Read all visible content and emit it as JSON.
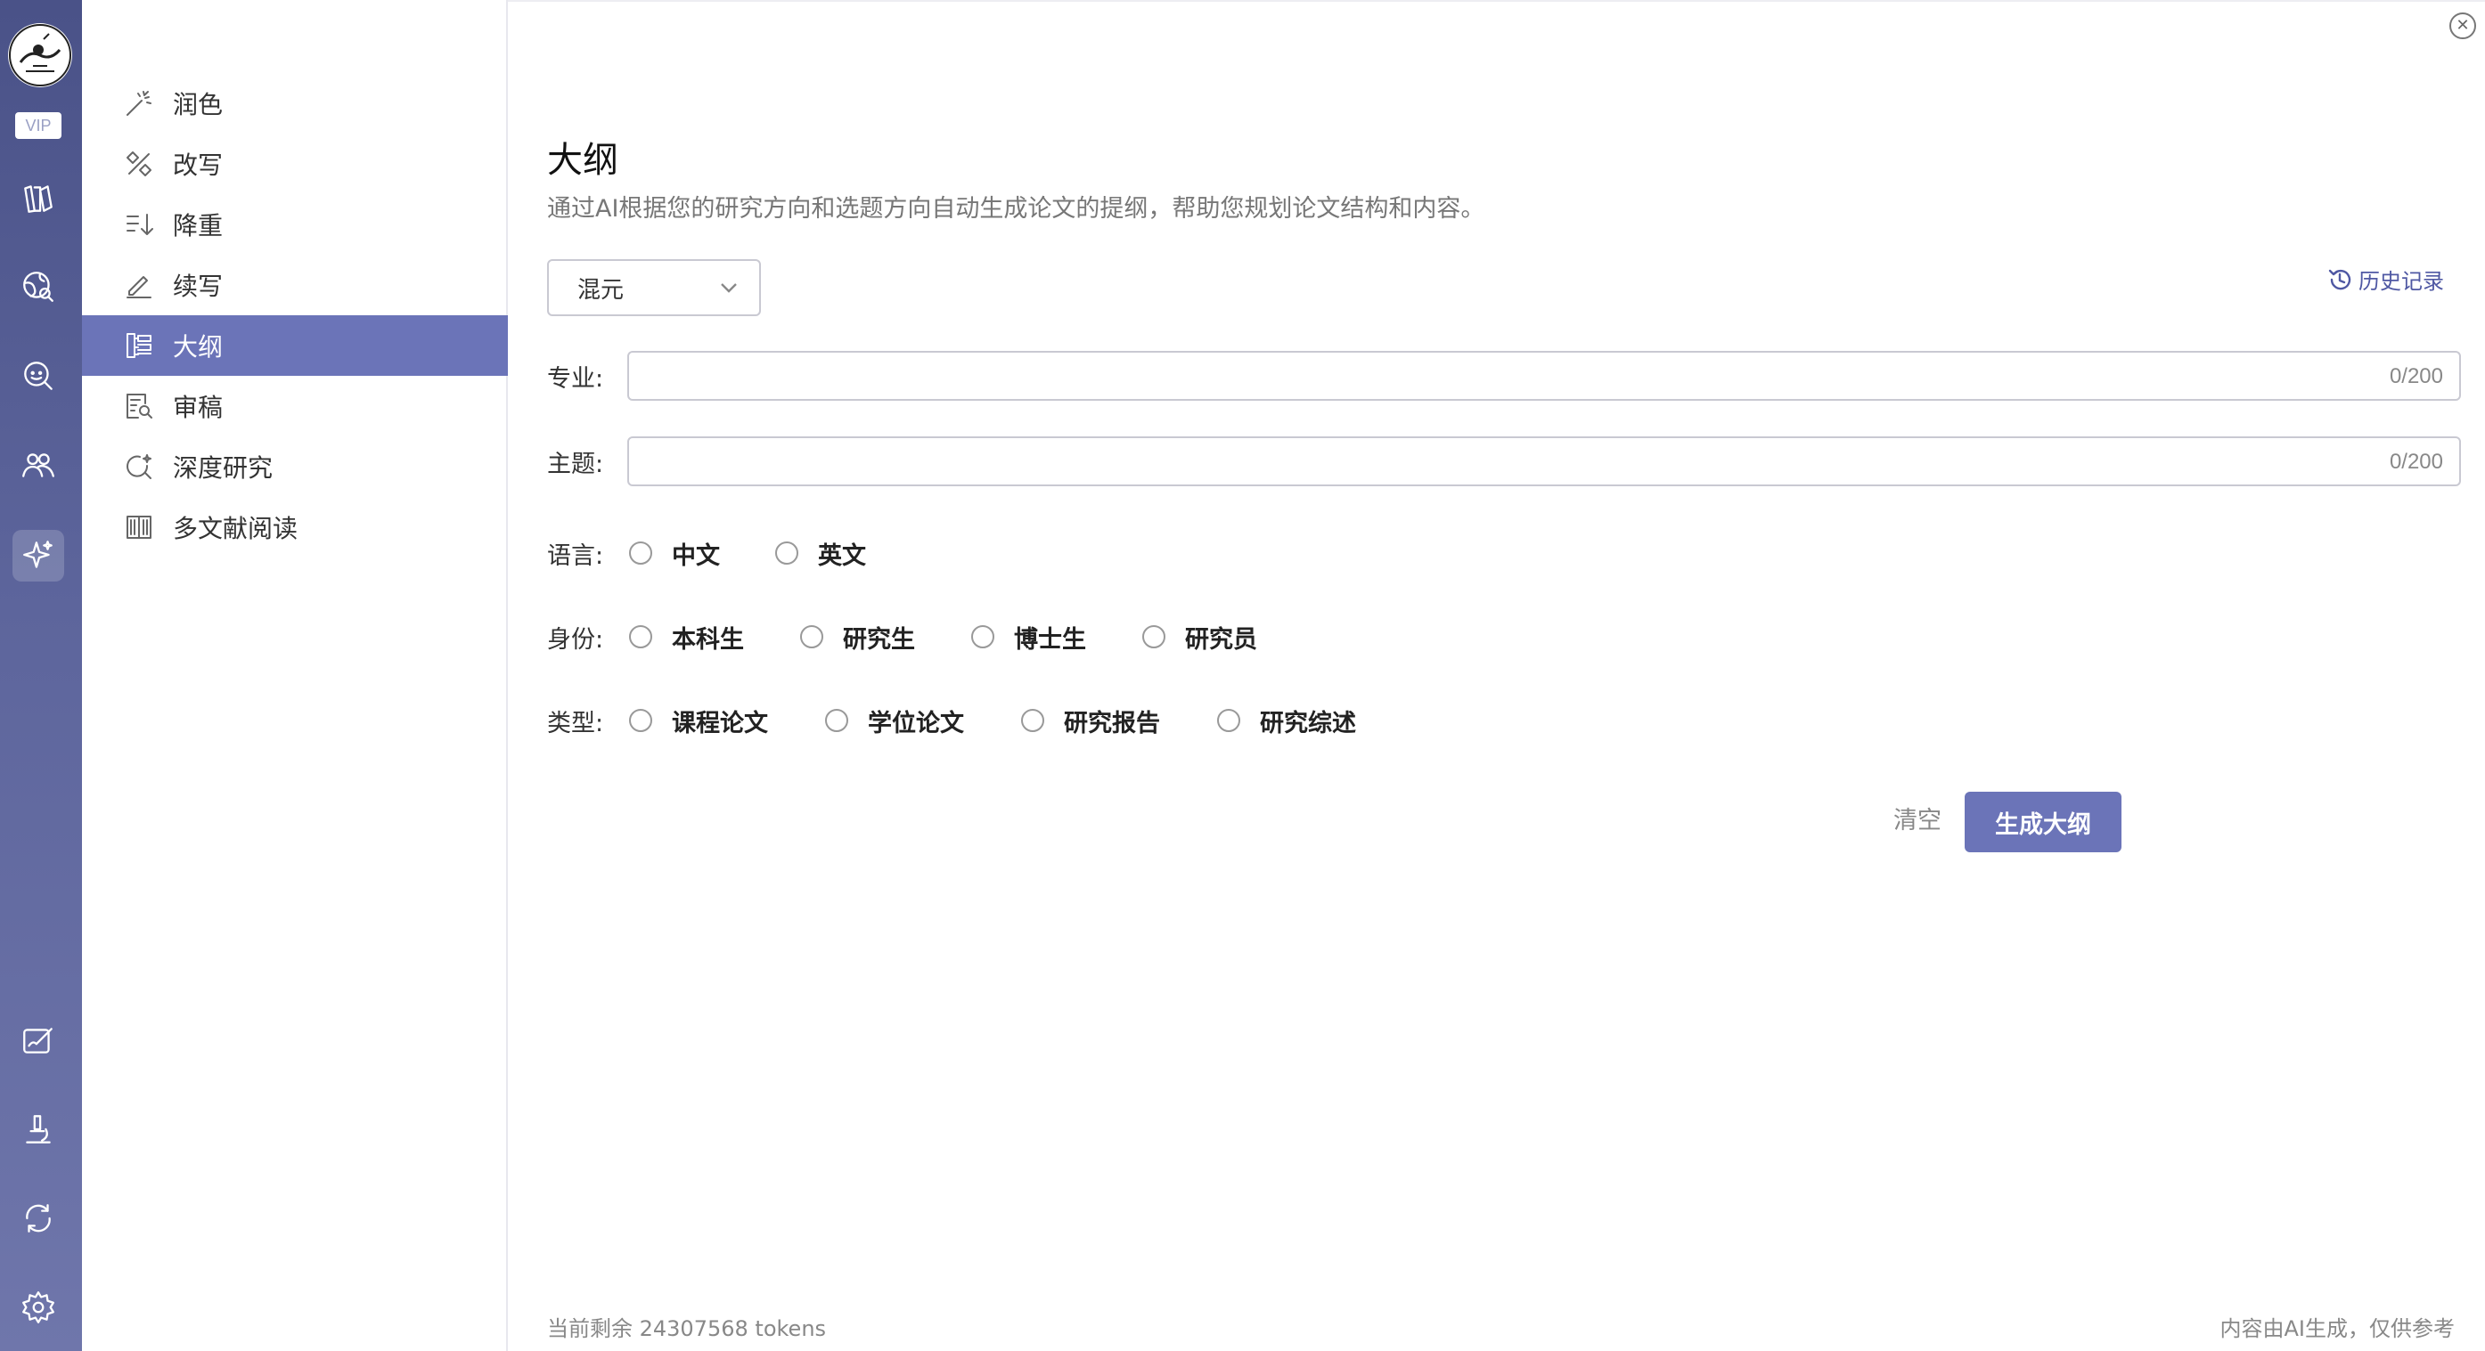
{
  "rail": {
    "vip_label": "VIP",
    "icons": [
      "library-icon",
      "globe-search-icon",
      "search-icon",
      "users-icon",
      "ai-sparkle-icon",
      "edit-icon",
      "microscope-icon",
      "refresh-icon",
      "settings-icon"
    ],
    "active": "ai-sparkle-icon"
  },
  "sidebar": {
    "items": [
      {
        "label": "润色",
        "icon": "magic-wand-icon"
      },
      {
        "label": "改写",
        "icon": "rewrite-icon"
      },
      {
        "label": "降重",
        "icon": "reduce-icon"
      },
      {
        "label": "续写",
        "icon": "pen-icon"
      },
      {
        "label": "大纲",
        "icon": "outline-icon"
      },
      {
        "label": "审稿",
        "icon": "review-icon"
      },
      {
        "label": "深度研究",
        "icon": "deep-research-icon"
      },
      {
        "label": "多文献阅读",
        "icon": "book-icon"
      }
    ],
    "active_index": 4
  },
  "main": {
    "title": "大纲",
    "subtitle": "通过AI根据您的研究方向和选题方向自动生成论文的提纲，帮助您规划论文结构和内容。",
    "model_select": "混元",
    "history_label": "历史记录",
    "fields": [
      {
        "label": "专业:",
        "value": "",
        "count": "0/200"
      },
      {
        "label": "主题:",
        "value": "",
        "count": "0/200"
      }
    ],
    "language": {
      "label": "语言:",
      "options": [
        "中文",
        "英文"
      ]
    },
    "identity": {
      "label": "身份:",
      "options": [
        "本科生",
        "研究生",
        "博士生",
        "研究员"
      ]
    },
    "type": {
      "label": "类型:",
      "options": [
        "课程论文",
        "学位论文",
        "研究报告",
        "研究综述"
      ]
    },
    "clear_label": "清空",
    "generate_label": "生成大纲",
    "tokens_remaining": "当前剩余 24307568 tokens",
    "disclaimer": "内容由AI生成，仅供参考"
  },
  "colors": {
    "accent": "#6b74b8",
    "rail_top": "#4a5288",
    "rail_bottom": "#6f76ab",
    "link": "#4f58a3"
  }
}
